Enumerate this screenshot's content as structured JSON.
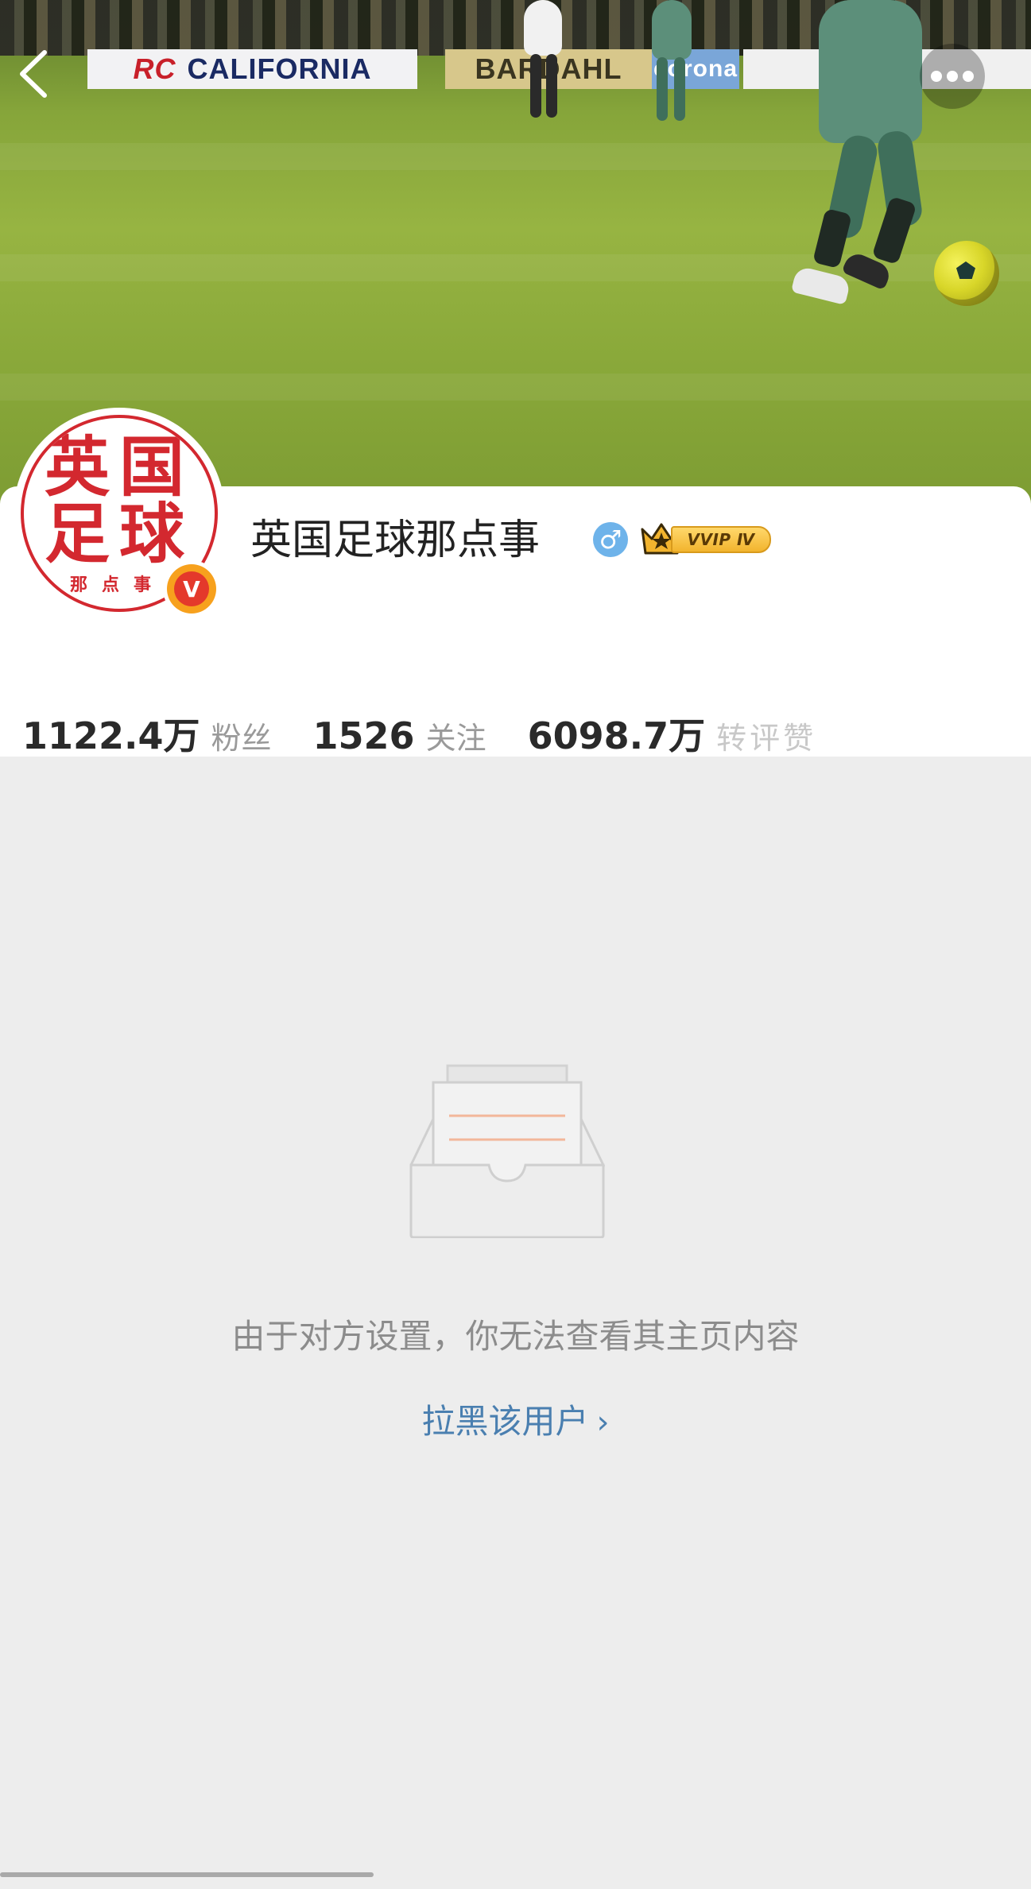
{
  "cover": {
    "boards": [
      "RC",
      "CALIFORNIA",
      "BARDAHL",
      "corona"
    ]
  },
  "nav": {
    "back_icon": "chevron-left-icon",
    "more_icon": "ellipsis-icon"
  },
  "profile": {
    "name": "英国足球那点事",
    "avatar_chars": [
      "英",
      "国",
      "足",
      "球"
    ],
    "avatar_sub": "那点事",
    "verified_letter": "V",
    "gender_symbol": "♂",
    "vip_label": "VVIP Ⅳ",
    "stats": [
      {
        "value": "1122.4万",
        "label": "粉丝"
      },
      {
        "value": "1526",
        "label": "关注"
      },
      {
        "value": "6098.7万",
        "label": "转评赞"
      }
    ]
  },
  "empty_state": {
    "message": "由于对方设置，你无法查看其主页内容",
    "action_label": "拉黑该用户",
    "action_chevron": "›",
    "illustration_icon": "empty-inbox-icon"
  },
  "colors": {
    "background": "#ededed",
    "link": "#4a7fb0",
    "brand_red": "#d3282f",
    "verified_orange": "#f7a11d",
    "vip_gold": "#f2b42e"
  }
}
